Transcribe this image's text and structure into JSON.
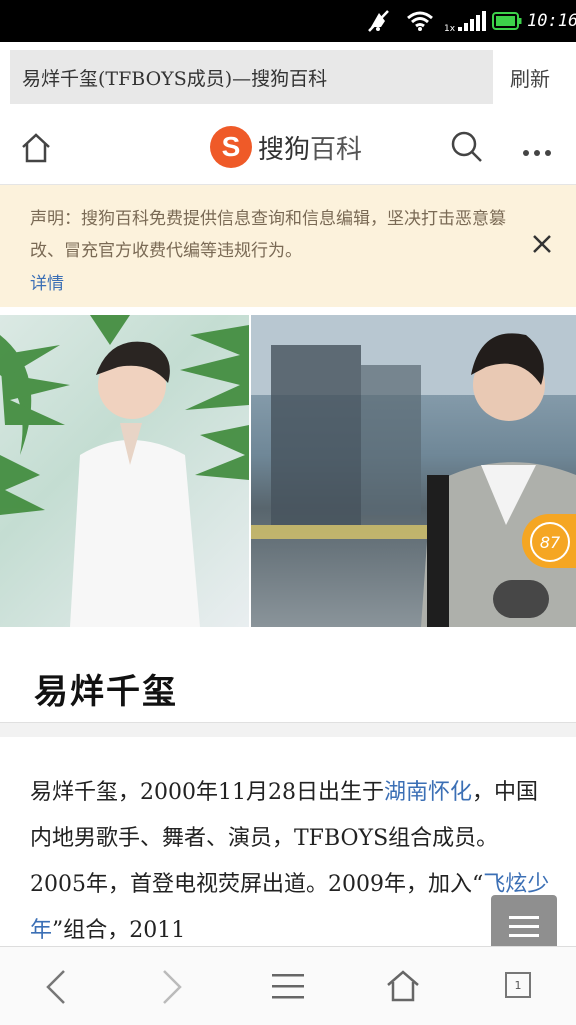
{
  "status_bar": {
    "time": "10:16",
    "icons": [
      "mute-icon",
      "wifi-icon",
      "signal-icon",
      "battery-icon"
    ],
    "battery_color": "#3dd14a"
  },
  "address_bar": {
    "title": "易烊千玺(TFBOYS成员)—搜狗百科",
    "refresh_label": "刷新"
  },
  "header": {
    "logo_mark": "S",
    "logo_text_1": "搜狗",
    "logo_text_2": "百科",
    "icons": [
      "home-icon",
      "search-icon",
      "more-icon"
    ],
    "brand_color": "#ef5a28"
  },
  "notice": {
    "text": "声明：搜狗百科免费提供信息查询和信息编辑，坚决打击恶意篡改、冒充官方收费代编等违规行为。",
    "link_label": "详情",
    "background": "#fcf2dc"
  },
  "photos": {
    "badge_count": "87",
    "badge_color": "#f5a623"
  },
  "entry": {
    "title": "易烊千玺",
    "paragraph": {
      "p1": "易烊千玺，2000年11月28日出生于",
      "link1": "湖南怀化",
      "p2": "，中国内地男歌手、舞者、演员，TFBOYS组合成员。2005年，首登电视荧屏出道。2009年，加入“",
      "link2": "飞炫少年",
      "p3": "”组合，2011"
    }
  },
  "bottom_bar": {
    "icons": [
      "back-icon",
      "forward-icon",
      "menu-icon",
      "home-icon",
      "tabs-icon"
    ],
    "tabs_count": "1"
  }
}
